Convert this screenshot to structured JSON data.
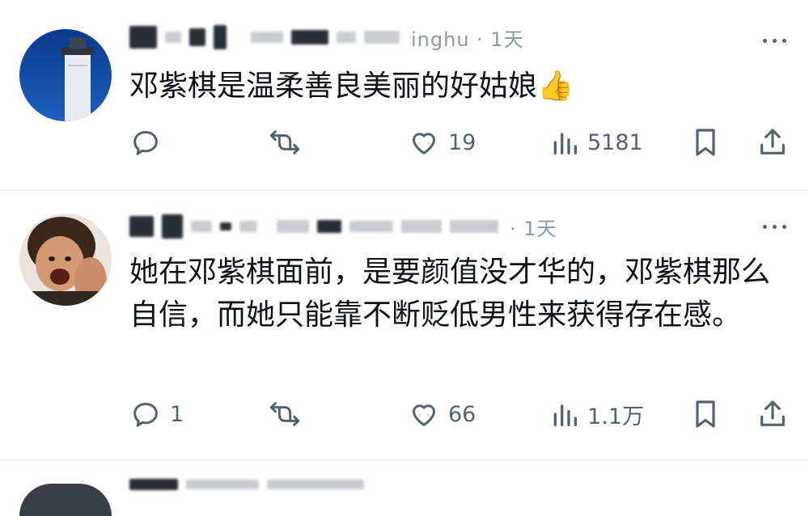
{
  "posts": [
    {
      "handle_visible": "inghu · 1天",
      "text": "邓紫棋是温柔善良美丽的好姑娘👍",
      "actions": {
        "reply_count": "",
        "like_count": "19",
        "view_count": "5181"
      }
    },
    {
      "handle_visible": "· 1天",
      "text": "她在邓紫棋面前，是要颜值没才华的，邓紫棋那么自信，而她只能靠不断贬低男性来获得存在感。",
      "actions": {
        "reply_count": "1",
        "like_count": "66",
        "view_count": "1.1万"
      }
    }
  ],
  "colors": {
    "text": "#0f1419",
    "secondary": "#536471",
    "divider": "#eff3f4"
  },
  "icons": [
    "reply-icon",
    "retweet-icon",
    "like-icon",
    "views-icon",
    "bookmark-icon",
    "share-icon",
    "more-icon"
  ]
}
